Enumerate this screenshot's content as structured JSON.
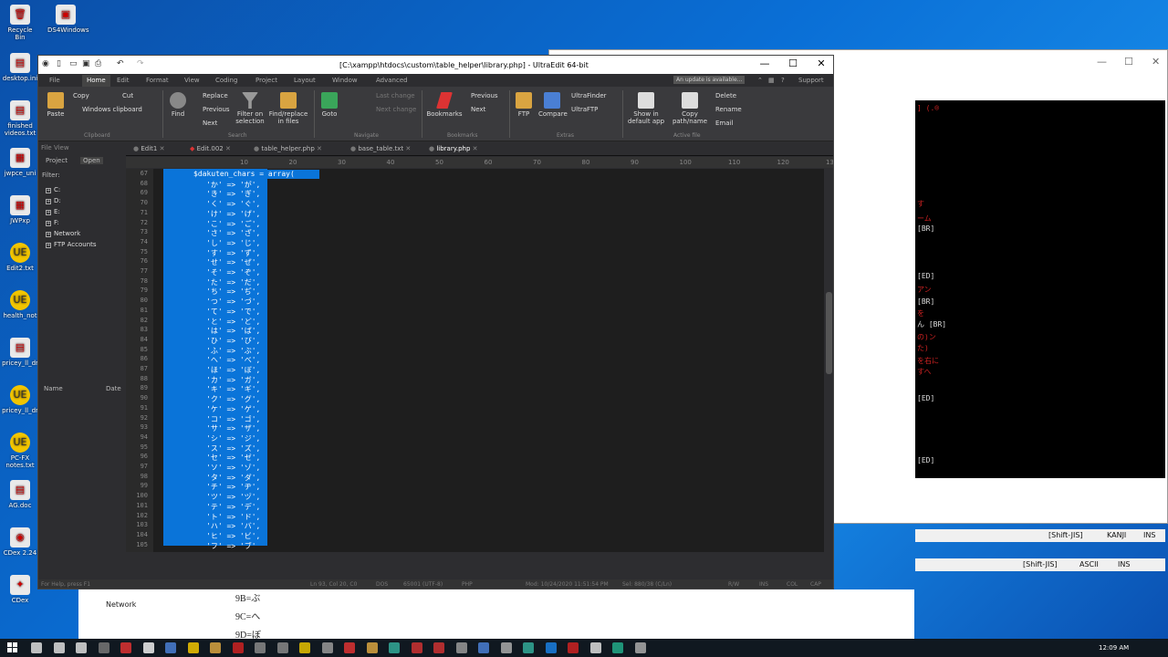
{
  "desktop": {
    "icons": [
      {
        "label": "Recycle Bin",
        "glyph": "🗑"
      },
      {
        "label": "DS4Windows",
        "glyph": "▣"
      },
      {
        "label": "desktop.ini",
        "glyph": "▤"
      },
      {
        "label": "finished videos.txt",
        "glyph": "▤"
      },
      {
        "label": "jwpce_uni",
        "glyph": "▦"
      },
      {
        "label": "JWPxp",
        "glyph": "▦"
      },
      {
        "label": "Edit2.txt",
        "glyph": "UE"
      },
      {
        "label": "health_not",
        "glyph": "UE"
      },
      {
        "label": "pricey_ll_dr",
        "glyph": "▤"
      },
      {
        "label": "pricey_ll_dr",
        "glyph": "UE"
      },
      {
        "label": "PC-FX notes.txt",
        "glyph": "UE"
      },
      {
        "label": "AG.doc",
        "glyph": "▤"
      },
      {
        "label": "CDex 2.24",
        "glyph": "◉"
      },
      {
        "label": "CDex",
        "glyph": "✦"
      }
    ]
  },
  "window": {
    "title": "[C:\\xampp\\htdocs\\custom\\table_helper\\library.php] - UltraEdit 64-bit",
    "min": "—",
    "max": "☐",
    "close": "✕"
  },
  "menu": [
    "File",
    "Home",
    "Edit",
    "Format",
    "View",
    "Coding",
    "Project",
    "Layout",
    "Window",
    "Advanced"
  ],
  "menu_active": "Home",
  "update_notice": "An update is available...",
  "support": "Support",
  "ribbon": {
    "paste": "Paste",
    "copy": "Copy",
    "cut": "Cut",
    "windows_clipboard": "Windows clipboard",
    "clipboard_group": "Clipboard",
    "find": "Find",
    "replace": "Replace",
    "previous": "Previous",
    "next": "Next",
    "filter_on_selection": "Filter on selection",
    "find_replace_in_files": "Find/replace in files",
    "search_group": "Search",
    "goto": "Goto",
    "last_change": "Last change",
    "next_change": "Next change",
    "navigate_group": "Navigate",
    "bookmarks": "Bookmarks",
    "bm_previous": "Previous",
    "bm_next": "Next",
    "bookmarks_group": "Bookmarks",
    "ftp": "FTP",
    "compare": "Compare",
    "ultrafinder": "UltraFinder",
    "ultraftp": "UltraFTP",
    "extras_group": "Extras",
    "show_default_app": "Show in default app",
    "copy_path": "Copy path/name",
    "delete": "Delete",
    "rename": "Rename",
    "email": "Email",
    "active_file_group": "Active file"
  },
  "panel": {
    "title": "File View",
    "tabs": [
      "Project",
      "Open"
    ],
    "filter": "Filter:",
    "tree": [
      "C:",
      "D:",
      "E:",
      "F:",
      "Network",
      "FTP Accounts"
    ],
    "col_name": "Name",
    "col_date": "Date"
  },
  "tabs": [
    {
      "label": "Edit1"
    },
    {
      "label": "Edit.002"
    },
    {
      "label": "table_helper.php"
    },
    {
      "label": "base_table.txt"
    },
    {
      "label": "library.php"
    }
  ],
  "ruler": [
    "10",
    "20",
    "30",
    "40",
    "50",
    "60",
    "70",
    "80",
    "90",
    "100",
    "110",
    "120",
    "130"
  ],
  "editor": {
    "first_line": "$dakuten_chars = array(",
    "line_numbers": [
      "67",
      "68",
      "69",
      "70",
      "71",
      "72",
      "73",
      "74",
      "75",
      "76",
      "77",
      "78",
      "79",
      "80",
      "81",
      "82",
      "83",
      "84",
      "85",
      "86",
      "87",
      "88",
      "89",
      "90",
      "91",
      "92",
      "93",
      "94",
      "95",
      "96",
      "97",
      "98",
      "99",
      "100",
      "101",
      "102",
      "103",
      "104",
      "105"
    ],
    "lines": [
      "'か' => 'が',",
      "'き' => 'ぎ',",
      "'く' => 'ぐ',",
      "'け' => 'げ',",
      "'こ' => 'ご',",
      "'さ' => 'ざ',",
      "'し' => 'じ',",
      "'す' => 'ず',",
      "'せ' => 'ぜ',",
      "'そ' => 'ぞ',",
      "'た' => 'だ',",
      "'ち' => 'ぢ',",
      "'つ' => 'づ',",
      "'て' => 'で',",
      "'と' => 'ど',",
      "'は' => 'ば',",
      "'ひ' => 'び',",
      "'ふ' => 'ぶ',",
      "'へ' => 'べ',",
      "'ほ' => 'ぼ',",
      "'カ' => 'ガ',",
      "'キ' => 'ギ',",
      "'ク' => 'グ',",
      "'ケ' => 'ゲ',",
      "'コ' => 'ゴ',",
      "'サ' => 'ザ',",
      "'シ' => 'ジ',",
      "'ス' => 'ズ',",
      "'セ' => 'ゼ',",
      "'ソ' => 'ゾ',",
      "'タ' => 'ダ',",
      "'チ' => 'ヂ',",
      "'ツ' => 'ヅ',",
      "'テ' => 'デ',",
      "'ト' => 'ド',",
      "'ハ' => 'バ',",
      "'ヒ' => 'ビ',",
      "'フ' => 'ブ'"
    ]
  },
  "status": {
    "help": "For Help, press F1",
    "position": "Ln 93, Col 20, C0",
    "line_end": "DOS",
    "encoding": "65001 (UTF-8)",
    "language": "PHP",
    "modified": "Mod: 10/24/2020 11:51:54 PM",
    "selection": "Sel: 880/38 (C/Ln)",
    "rw": "R/W",
    "ins": "INS",
    "col": "COL",
    "cap": "CAP"
  },
  "background": {
    "black_lines": [
      "] (.®",
      "す",
      "ーム",
      "[BR]",
      "[ED]",
      "アン",
      "[BR]",
      "を",
      "ん [BR]",
      "の)ン",
      "た)",
      "を右に",
      "すへ",
      "[ED]",
      "[ED]"
    ],
    "white_lines": [
      "9B=ぶ",
      "9C=へ",
      "9D=ぼ"
    ],
    "network": "Network",
    "status1": [
      "[Shift-JIS]",
      "KANJI",
      "INS"
    ],
    "status2": [
      "[Shift-JIS]",
      "ASCII",
      "INS"
    ]
  },
  "clock": "12:09 AM"
}
